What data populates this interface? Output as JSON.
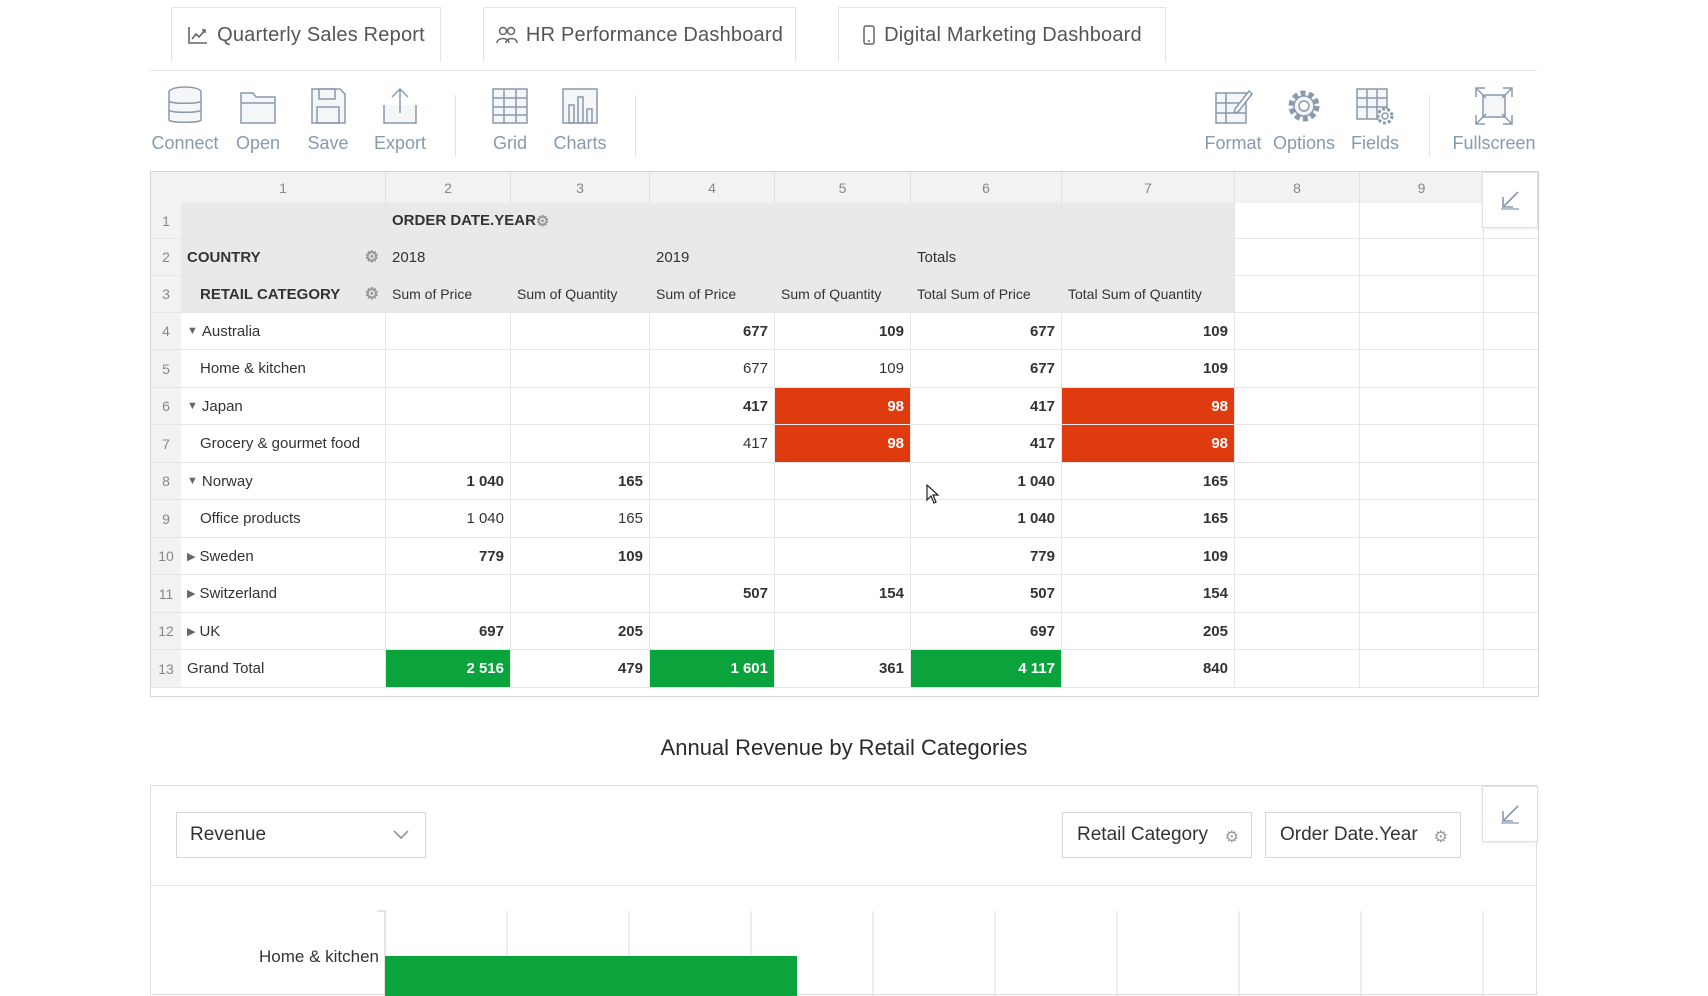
{
  "tabs": [
    {
      "label": "Quarterly Sales Report"
    },
    {
      "label": "HR Performance Dashboard"
    },
    {
      "label": "Digital Marketing Dashboard"
    }
  ],
  "toolbar": {
    "connect": "Connect",
    "open": "Open",
    "save": "Save",
    "export": "Export",
    "grid": "Grid",
    "charts": "Charts",
    "format": "Format",
    "options": "Options",
    "fields": "Fields",
    "fullscreen": "Fullscreen"
  },
  "grid": {
    "col_numbers": [
      "1",
      "2",
      "3",
      "4",
      "5",
      "6",
      "7",
      "8",
      "9"
    ],
    "row_numbers": [
      "1",
      "2",
      "3",
      "4",
      "5",
      "6",
      "7",
      "8",
      "9",
      "10",
      "11",
      "12",
      "13"
    ],
    "header": {
      "order_date": "ORDER DATE.YEAR",
      "country": "COUNTRY",
      "retail_category": "RETAIL CATEGORY",
      "year_2018": "2018",
      "year_2019": "2019",
      "totals": "Totals",
      "measures": [
        "Sum of Price",
        "Sum of Quantity",
        "Sum of Price",
        "Sum of Quantity",
        "Total Sum of Price",
        "Total Sum of Quantity"
      ]
    },
    "rows": [
      {
        "label": "Australia",
        "expand": "down",
        "bold": true,
        "values": [
          "",
          "",
          "677",
          "109",
          "677",
          "109"
        ]
      },
      {
        "label": "Home & kitchen",
        "child": true,
        "values": [
          "",
          "",
          "677",
          "109",
          "677",
          "109"
        ]
      },
      {
        "label": "Japan",
        "expand": "down",
        "bold": true,
        "values": [
          "",
          "",
          "417",
          "98",
          "417",
          "98"
        ]
      },
      {
        "label": "Grocery & gourmet food",
        "child": true,
        "values": [
          "",
          "",
          "417",
          "98",
          "417",
          "98"
        ]
      },
      {
        "label": "Norway",
        "expand": "down",
        "bold": true,
        "values": [
          "1 040",
          "165",
          "",
          "",
          "1 040",
          "165"
        ]
      },
      {
        "label": "Office products",
        "child": true,
        "values": [
          "1 040",
          "165",
          "",
          "",
          "1 040",
          "165"
        ]
      },
      {
        "label": "Sweden",
        "expand": "right",
        "bold": true,
        "values": [
          "779",
          "109",
          "",
          "",
          "779",
          "109"
        ]
      },
      {
        "label": "Switzerland",
        "expand": "right",
        "bold": true,
        "values": [
          "",
          "",
          "507",
          "154",
          "507",
          "154"
        ]
      },
      {
        "label": "UK",
        "expand": "right",
        "bold": true,
        "values": [
          "697",
          "205",
          "",
          "",
          "697",
          "205"
        ]
      },
      {
        "label": "Grand Total",
        "total": true,
        "values": [
          "2 516",
          "479",
          "1 601",
          "361",
          "4 117",
          "840"
        ]
      }
    ],
    "colors": {
      "red": "#e03a0f",
      "green": "#0aa33c"
    }
  },
  "chart_section": {
    "title": "Annual Revenue by Retail Categories",
    "measure_select": "Revenue",
    "retail_category_button": "Retail Category",
    "order_date_button": "Order Date.Year"
  },
  "chart_data": {
    "type": "bar",
    "orientation": "horizontal",
    "categories": [
      "Home & kitchen"
    ],
    "series": [
      {
        "values": [
          677
        ],
        "color": "#0aa33c"
      }
    ],
    "visible_partial": true
  }
}
